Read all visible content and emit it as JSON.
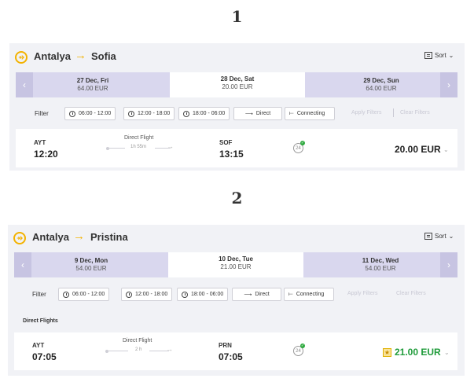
{
  "sections": [
    {
      "number": "1",
      "route": {
        "from": "Antalya",
        "arrow": "→",
        "to": "Sofia"
      },
      "sort_label": "Sort",
      "dates": [
        {
          "date": "27 Dec, Fri",
          "price": "64.00 EUR"
        },
        {
          "date": "28 Dec, Sat",
          "price": "20.00 EUR"
        },
        {
          "date": "29 Dec, Sun",
          "price": "64.00 EUR"
        }
      ],
      "filter": {
        "label": "Filter",
        "chips": [
          "06:00 - 12:00",
          "12:00 - 18:00",
          "18:00 - 06:00",
          "Direct",
          "Connecting"
        ],
        "apply": "Apply Filters",
        "clear": "Clear Filters"
      },
      "flight": {
        "dep_code": "AYT",
        "dep_time": "12:20",
        "type": "Direct Flight",
        "duration": "1h 55m",
        "arr_code": "SOF",
        "arr_time": "13:15",
        "badge": "24",
        "price": "20.00 EUR"
      }
    },
    {
      "number": "2",
      "route": {
        "from": "Antalya",
        "arrow": "→",
        "to": "Pristina"
      },
      "sort_label": "Sort",
      "dates": [
        {
          "date": "9 Dec, Mon",
          "price": "54.00 EUR"
        },
        {
          "date": "10 Dec, Tue",
          "price": "21.00 EUR"
        },
        {
          "date": "11 Dec, Wed",
          "price": "54.00 EUR"
        }
      ],
      "filter": {
        "label": "Filter",
        "chips": [
          "06:00 - 12:00",
          "12:00 - 18:00",
          "18:00 - 06:00",
          "Direct",
          "Connecting"
        ],
        "apply": "Apply Filters",
        "clear": "Clear Filters"
      },
      "subheading": "Direct Flights",
      "flight": {
        "dep_code": "AYT",
        "dep_time": "07:05",
        "type": "Direct Flight",
        "duration": "2 h",
        "arr_code": "PRN",
        "arr_time": "07:05",
        "badge": "24",
        "price": "21.00 EUR"
      }
    }
  ],
  "colors": {
    "accent": "#f3b200",
    "date_bar": "#d9d7ee",
    "nav": "#c7c4e2",
    "price_green": "#1f9b3a"
  },
  "icons": [
    "plane-icon",
    "sort-icon",
    "chevron-down-icon",
    "chevron-left-icon",
    "chevron-right-icon",
    "clock-icon",
    "arrow-right-icon",
    "connecting-icon",
    "24h-icon",
    "check-icon",
    "star-icon"
  ]
}
